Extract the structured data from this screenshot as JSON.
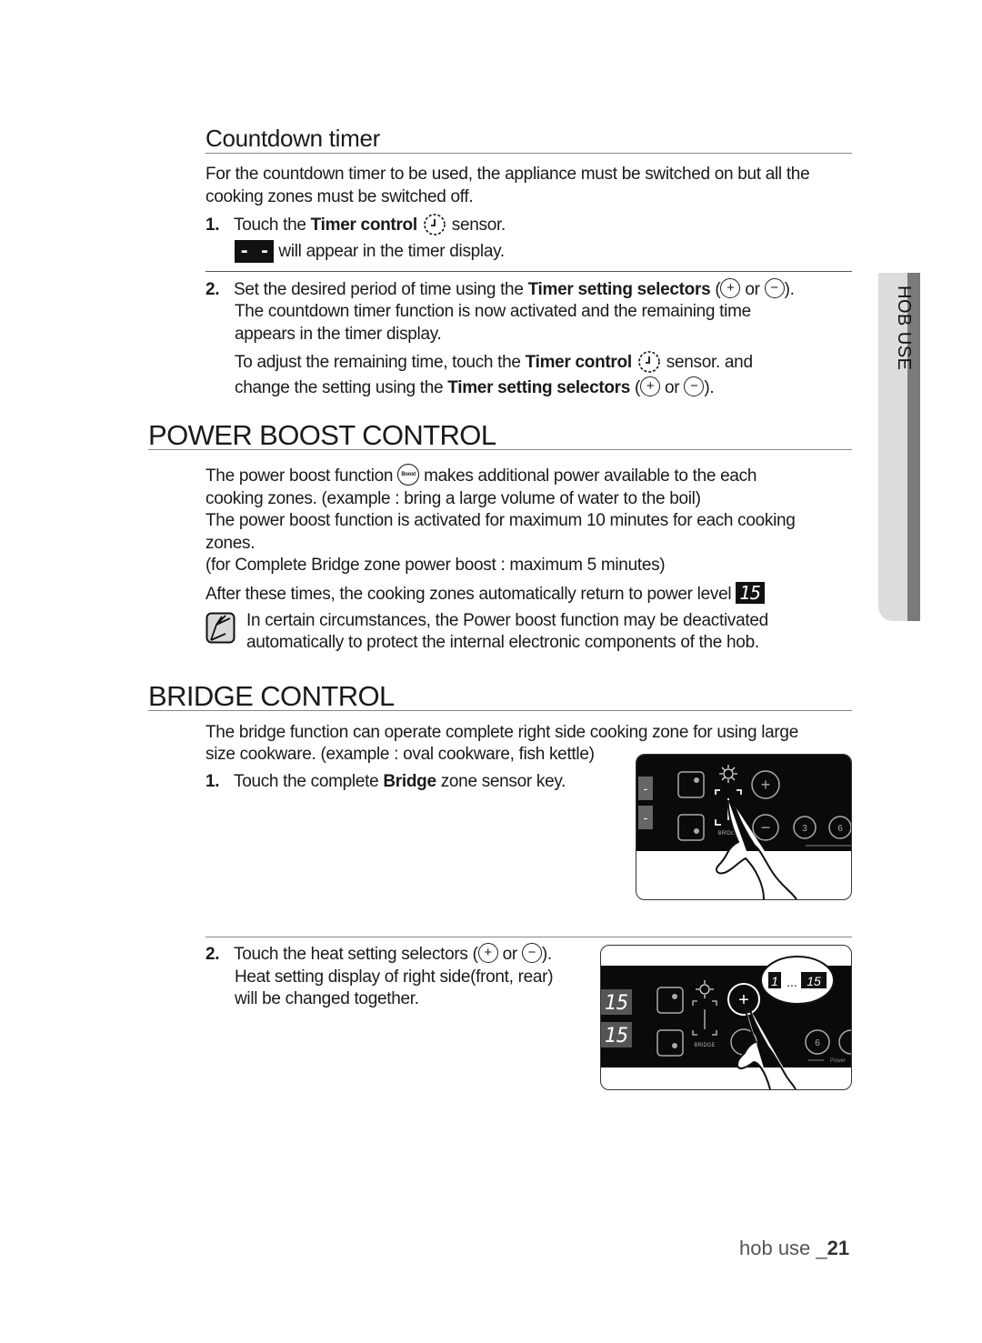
{
  "side_tab": {
    "label": "HOB USE"
  },
  "countdown": {
    "title": "Countdown timer",
    "intro": "For the countdown timer to be used, the appliance must be switched on but all the cooking zones must be switched off.",
    "step1": {
      "num": "1.",
      "pre": "Touch the ",
      "bold": "Timer control",
      "post": " sensor.",
      "display_symbol": "- -",
      "display_text": " will appear in the timer display."
    },
    "step2": {
      "num": "2.",
      "pre": "Set the desired period of time using the ",
      "bold": "Timer setting selectors",
      "open": " (",
      "or": " or ",
      "close": ").",
      "line2": "The countdown timer function is now activated and the remaining time",
      "line3": "appears in the timer display.",
      "adjust_pre": "To adjust the remaining time, touch the ",
      "adjust_bold": "Timer control",
      "adjust_post": " sensor. and",
      "change_pre": "change the setting using the ",
      "change_bold": "Timer setting selectors",
      "change_open": " (",
      "change_or": " or ",
      "change_close": ")."
    }
  },
  "power_boost": {
    "title": "POWER BOOST CONTROL",
    "p1_pre": "The power boost function ",
    "boost_icon_label": "Boost",
    "p1_post": " makes additional power available to the each",
    "p1_line2": "cooking zones. (example : bring a large volume of water to the boil)",
    "p2_line1": "The power boost function is activated for maximum 10 minutes for each cooking",
    "p2_line2": "zones.",
    "p3": "(for Complete Bridge zone power boost : maximum 5 minutes)",
    "p4": "After these times, the cooking zones automatically return to power level",
    "power_level_display": "15",
    "note_line1": "In certain circumstances, the Power boost function may be deactivated",
    "note_line2": "automatically to protect the internal electronic components of the hob."
  },
  "bridge": {
    "title": "BRIDGE CONTROL",
    "intro_line1": "The bridge function can operate complete right side cooking zone for using large",
    "intro_line2": "size cookware. (example : oval cookware, fish kettle)",
    "step1": {
      "num": "1.",
      "pre": "Touch the complete ",
      "bold": "Bridge",
      "post": " zone sensor key."
    },
    "step2": {
      "num": "2.",
      "pre": "Touch the heat setting selectors (",
      "or": " or ",
      "close": ").",
      "line2": "Heat setting display of right side(front, rear)",
      "line3": "will be changed together."
    },
    "figure1": {
      "minus_label": "-",
      "bridge_label": "BRIDGE",
      "key_3": "3",
      "key_6": "6"
    },
    "figure2": {
      "display_front": "15",
      "display_rear": "15",
      "bridge_label": "BRIDGE",
      "key_6": "6",
      "power_label": "Power",
      "bubble_from": "1",
      "bubble_dots": "...",
      "bubble_to": "15"
    }
  },
  "footer": {
    "section": "hob use _",
    "page": "21"
  }
}
